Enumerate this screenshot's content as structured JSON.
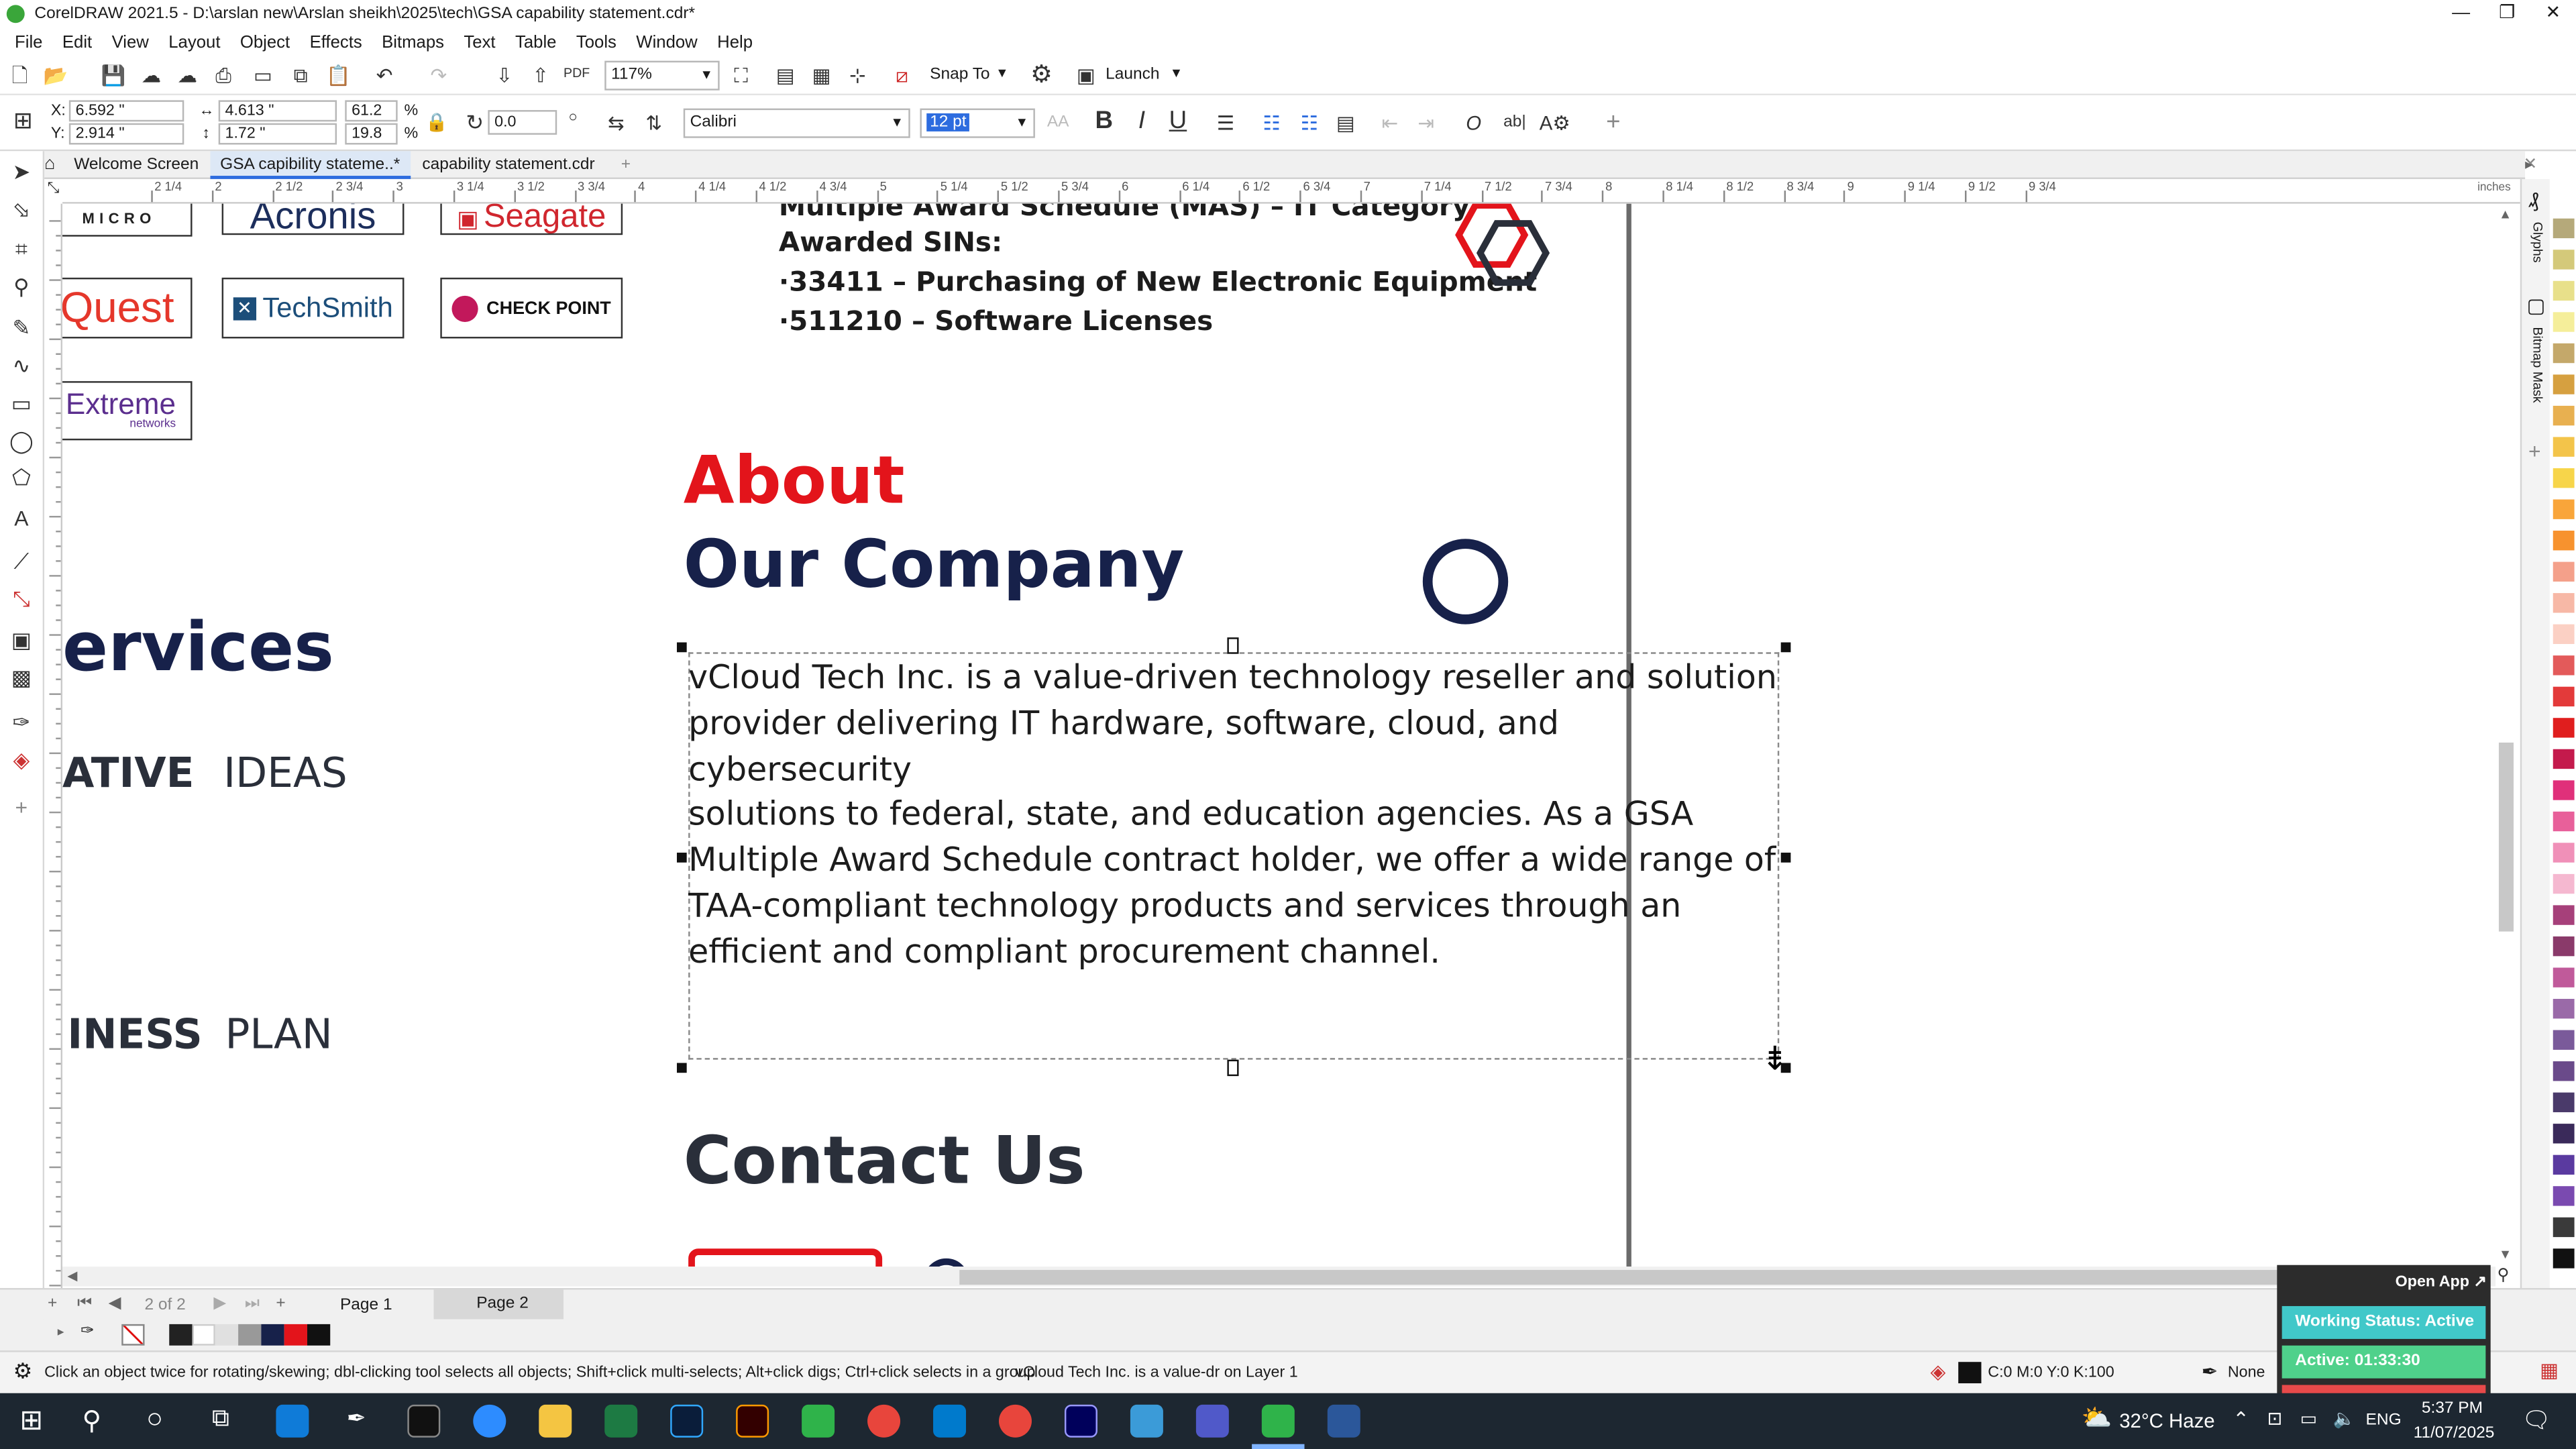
{
  "window": {
    "title": "CorelDRAW 2021.5 - D:\\arslan new\\Arslan sheikh\\2025\\tech\\GSA  capability statement.cdr*",
    "controls": [
      "—",
      "❐",
      "✕"
    ]
  },
  "menu": [
    "File",
    "Edit",
    "View",
    "Layout",
    "Object",
    "Effects",
    "Bitmaps",
    "Text",
    "Table",
    "Tools",
    "Window",
    "Help"
  ],
  "standard_toolbar": {
    "zoom": "117%",
    "snap_to": "Snap To",
    "launch": "Launch"
  },
  "property_bar": {
    "x": "6.592 \"",
    "y": "2.914 \"",
    "width": "4.613 \"",
    "height": "1.72 \"",
    "scale_w": "61.2",
    "scale_h": "19.8",
    "percent": "%",
    "rotation": "0.0",
    "font": "Calibri",
    "font_size": "12 pt",
    "bold": "B",
    "italic": "I",
    "underline": "U"
  },
  "doc_tabs": [
    {
      "label": "Welcome Screen"
    },
    {
      "label": "GSA  capibility stateme..*"
    },
    {
      "label": "capability statement.cdr"
    }
  ],
  "ruler": {
    "units": "inches",
    "ticks": [
      "2 1/4",
      "2",
      "2 1/2",
      "2 3/4",
      "3",
      "3 1/4",
      "3 1/2",
      "3 3/4",
      "4",
      "4 1/4",
      "4 1/2",
      "4 3/4",
      "5",
      "5 1/4",
      "5 1/2",
      "5 3/4",
      "6",
      "6 1/4",
      "6 1/2",
      "6 3/4",
      "7",
      "7 1/4",
      "7 1/2",
      "7 3/4",
      "8",
      "8 1/4",
      "8 1/2",
      "8 3/4",
      "9",
      "9 1/4",
      "9 1/2",
      "9 3/4"
    ]
  },
  "canvas": {
    "partners": {
      "micro": "MICRO",
      "acronis": "Acronis",
      "seagate": "Seagate",
      "quest": "Quest",
      "techsmith": "TechSmith",
      "checkpoint": "CHECK POINT",
      "extreme": "Extreme",
      "extreme_sub": "networks"
    },
    "left_col": {
      "services": "ervices",
      "ideas_bold": "ATIVE",
      "ideas_light": "IDEAS",
      "plan_bold": "INESS",
      "plan_light": "PLAN"
    },
    "mas_title": "Multiple Award Schedule (MAS) – IT Category",
    "sins_title": "Awarded SINs:",
    "sin1": "·33411 – Purchasing of New Electronic Equipment",
    "sin2": "·511210 – Software Licenses",
    "about": "About",
    "our_company": "Our Company",
    "body_lines": [
      "vCloud Tech Inc. is a value-driven technology reseller and solution",
      "provider delivering IT hardware, software, cloud, and cybersecurity",
      "solutions to federal, state, and education agencies. As a GSA",
      "Multiple Award Schedule contract holder, we offer a wide range of",
      "TAA-compliant technology products and services through an",
      "efficient and compliant procurement channel."
    ],
    "contact": "Contact Us"
  },
  "dockers": [
    "Glyphs",
    "Bitmap Mask"
  ],
  "pages": {
    "counter": "2 of 2",
    "page1": "Page 1",
    "page2": "Page 2"
  },
  "status": {
    "hint": "Click an object twice for rotating/skewing; dbl-clicking tool selects all objects; Shift+click multi-selects; Alt+click digs; Ctrl+click selects in a group",
    "object_info": "vCloud Tech Inc. is a value-dr on Layer 1",
    "fill": "C:0 M:0 Y:0 K:100",
    "outline": "None"
  },
  "timer_widget": {
    "open_app": "Open App ↗",
    "working_status": "Working Status: Active",
    "active_time": "Active: 01:33:30"
  },
  "taskbar": {
    "weather": "32°C  Haze",
    "language": "ENG",
    "time": "5:37 PM",
    "date": "11/07/2025"
  },
  "colors": {
    "navy": "#17214a",
    "red": "#e3141b",
    "dark_text": "#2a2f3a",
    "status_green": "#4fd18b",
    "status_teal": "#41c8c9",
    "taskbar": "#1d2731"
  },
  "palette_colors": [
    "#b5a97a",
    "#d4c97a",
    "#e8e08a",
    "#f5ee9a",
    "#c4a86a",
    "#d6a040",
    "#e8b050",
    "#f3c44a",
    "#f7d54a",
    "#f9a53a",
    "#f7922e",
    "#f4a08a",
    "#f7b8a6",
    "#fbd0c4",
    "#e35a5a",
    "#e33a3a",
    "#e01e1e",
    "#c41a4c",
    "#e0307a",
    "#e8609a",
    "#f090b8",
    "#f5b8d0",
    "#a6407a",
    "#8a3a6a",
    "#c05a9a",
    "#9a6aa8",
    "#7a5a9a",
    "#6a4a8a",
    "#4a3a6a",
    "#3a2a5a",
    "#5a3aa0",
    "#7a4ab0",
    "#3a3a3a",
    "#111111"
  ]
}
